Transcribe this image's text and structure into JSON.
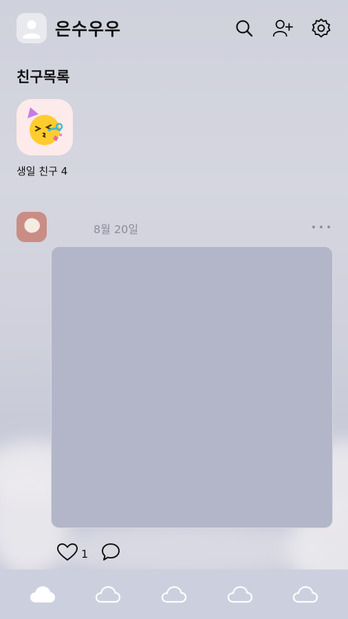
{
  "header": {
    "username": "은수우우",
    "icons": [
      "search-icon",
      "add-friend-icon",
      "settings-icon"
    ]
  },
  "friends": {
    "title": "친구목록",
    "birthday_label": "생일 친구 4",
    "birthday_icon": "party-emoji-icon"
  },
  "post": {
    "date": "8월 20일",
    "like_count": "1",
    "media_color": "#b3b5c8"
  },
  "bottom_nav": {
    "items": [
      "home-cloud-icon",
      "cloud-icon",
      "cloud-icon",
      "cloud-icon",
      "cloud-icon"
    ],
    "active_index": 0
  },
  "colors": {
    "background": "#cfd1dc",
    "nav_background": "#ccd0de",
    "text": "#111111",
    "muted_text": "#8a8d99"
  }
}
